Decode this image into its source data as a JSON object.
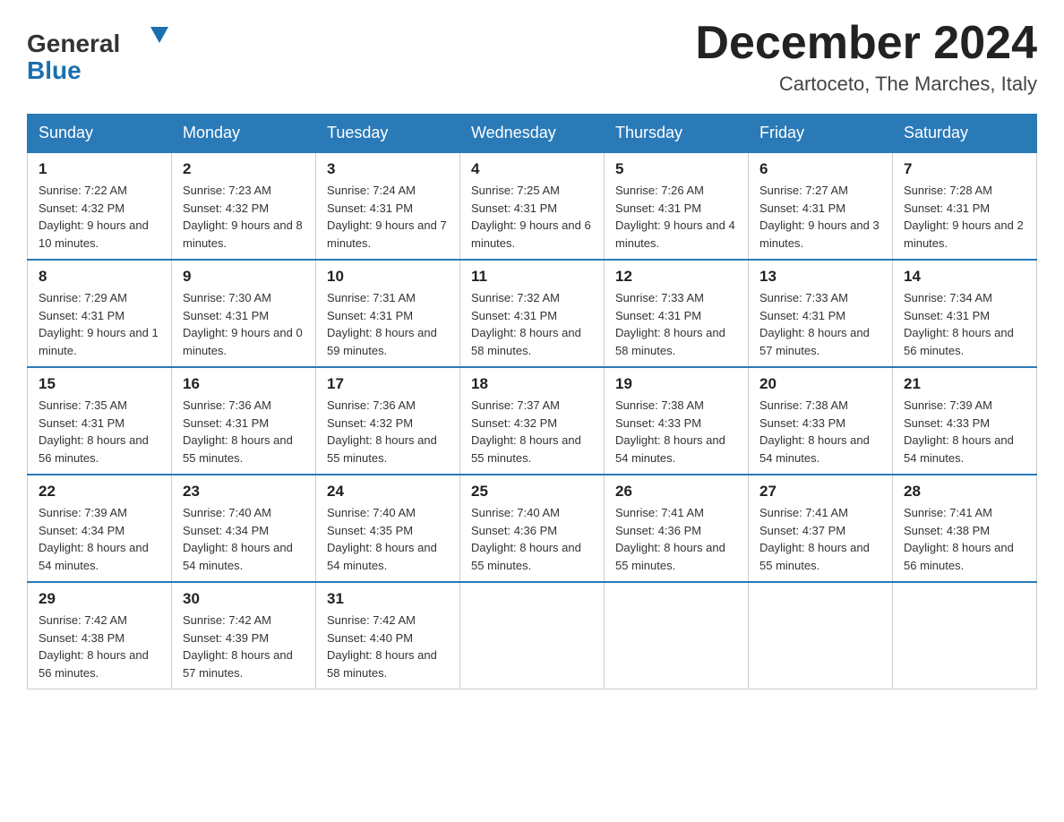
{
  "header": {
    "logo_general": "General",
    "logo_blue": "Blue",
    "month_year": "December 2024",
    "location": "Cartoceto, The Marches, Italy"
  },
  "days_of_week": [
    "Sunday",
    "Monday",
    "Tuesday",
    "Wednesday",
    "Thursday",
    "Friday",
    "Saturday"
  ],
  "weeks": [
    [
      {
        "day": "1",
        "sunrise": "7:22 AM",
        "sunset": "4:32 PM",
        "daylight": "9 hours and 10 minutes."
      },
      {
        "day": "2",
        "sunrise": "7:23 AM",
        "sunset": "4:32 PM",
        "daylight": "9 hours and 8 minutes."
      },
      {
        "day": "3",
        "sunrise": "7:24 AM",
        "sunset": "4:31 PM",
        "daylight": "9 hours and 7 minutes."
      },
      {
        "day": "4",
        "sunrise": "7:25 AM",
        "sunset": "4:31 PM",
        "daylight": "9 hours and 6 minutes."
      },
      {
        "day": "5",
        "sunrise": "7:26 AM",
        "sunset": "4:31 PM",
        "daylight": "9 hours and 4 minutes."
      },
      {
        "day": "6",
        "sunrise": "7:27 AM",
        "sunset": "4:31 PM",
        "daylight": "9 hours and 3 minutes."
      },
      {
        "day": "7",
        "sunrise": "7:28 AM",
        "sunset": "4:31 PM",
        "daylight": "9 hours and 2 minutes."
      }
    ],
    [
      {
        "day": "8",
        "sunrise": "7:29 AM",
        "sunset": "4:31 PM",
        "daylight": "9 hours and 1 minute."
      },
      {
        "day": "9",
        "sunrise": "7:30 AM",
        "sunset": "4:31 PM",
        "daylight": "9 hours and 0 minutes."
      },
      {
        "day": "10",
        "sunrise": "7:31 AM",
        "sunset": "4:31 PM",
        "daylight": "8 hours and 59 minutes."
      },
      {
        "day": "11",
        "sunrise": "7:32 AM",
        "sunset": "4:31 PM",
        "daylight": "8 hours and 58 minutes."
      },
      {
        "day": "12",
        "sunrise": "7:33 AM",
        "sunset": "4:31 PM",
        "daylight": "8 hours and 58 minutes."
      },
      {
        "day": "13",
        "sunrise": "7:33 AM",
        "sunset": "4:31 PM",
        "daylight": "8 hours and 57 minutes."
      },
      {
        "day": "14",
        "sunrise": "7:34 AM",
        "sunset": "4:31 PM",
        "daylight": "8 hours and 56 minutes."
      }
    ],
    [
      {
        "day": "15",
        "sunrise": "7:35 AM",
        "sunset": "4:31 PM",
        "daylight": "8 hours and 56 minutes."
      },
      {
        "day": "16",
        "sunrise": "7:36 AM",
        "sunset": "4:31 PM",
        "daylight": "8 hours and 55 minutes."
      },
      {
        "day": "17",
        "sunrise": "7:36 AM",
        "sunset": "4:32 PM",
        "daylight": "8 hours and 55 minutes."
      },
      {
        "day": "18",
        "sunrise": "7:37 AM",
        "sunset": "4:32 PM",
        "daylight": "8 hours and 55 minutes."
      },
      {
        "day": "19",
        "sunrise": "7:38 AM",
        "sunset": "4:33 PM",
        "daylight": "8 hours and 54 minutes."
      },
      {
        "day": "20",
        "sunrise": "7:38 AM",
        "sunset": "4:33 PM",
        "daylight": "8 hours and 54 minutes."
      },
      {
        "day": "21",
        "sunrise": "7:39 AM",
        "sunset": "4:33 PM",
        "daylight": "8 hours and 54 minutes."
      }
    ],
    [
      {
        "day": "22",
        "sunrise": "7:39 AM",
        "sunset": "4:34 PM",
        "daylight": "8 hours and 54 minutes."
      },
      {
        "day": "23",
        "sunrise": "7:40 AM",
        "sunset": "4:34 PM",
        "daylight": "8 hours and 54 minutes."
      },
      {
        "day": "24",
        "sunrise": "7:40 AM",
        "sunset": "4:35 PM",
        "daylight": "8 hours and 54 minutes."
      },
      {
        "day": "25",
        "sunrise": "7:40 AM",
        "sunset": "4:36 PM",
        "daylight": "8 hours and 55 minutes."
      },
      {
        "day": "26",
        "sunrise": "7:41 AM",
        "sunset": "4:36 PM",
        "daylight": "8 hours and 55 minutes."
      },
      {
        "day": "27",
        "sunrise": "7:41 AM",
        "sunset": "4:37 PM",
        "daylight": "8 hours and 55 minutes."
      },
      {
        "day": "28",
        "sunrise": "7:41 AM",
        "sunset": "4:38 PM",
        "daylight": "8 hours and 56 minutes."
      }
    ],
    [
      {
        "day": "29",
        "sunrise": "7:42 AM",
        "sunset": "4:38 PM",
        "daylight": "8 hours and 56 minutes."
      },
      {
        "day": "30",
        "sunrise": "7:42 AM",
        "sunset": "4:39 PM",
        "daylight": "8 hours and 57 minutes."
      },
      {
        "day": "31",
        "sunrise": "7:42 AM",
        "sunset": "4:40 PM",
        "daylight": "8 hours and 58 minutes."
      },
      null,
      null,
      null,
      null
    ]
  ],
  "labels": {
    "sunrise": "Sunrise:",
    "sunset": "Sunset:",
    "daylight": "Daylight:"
  }
}
